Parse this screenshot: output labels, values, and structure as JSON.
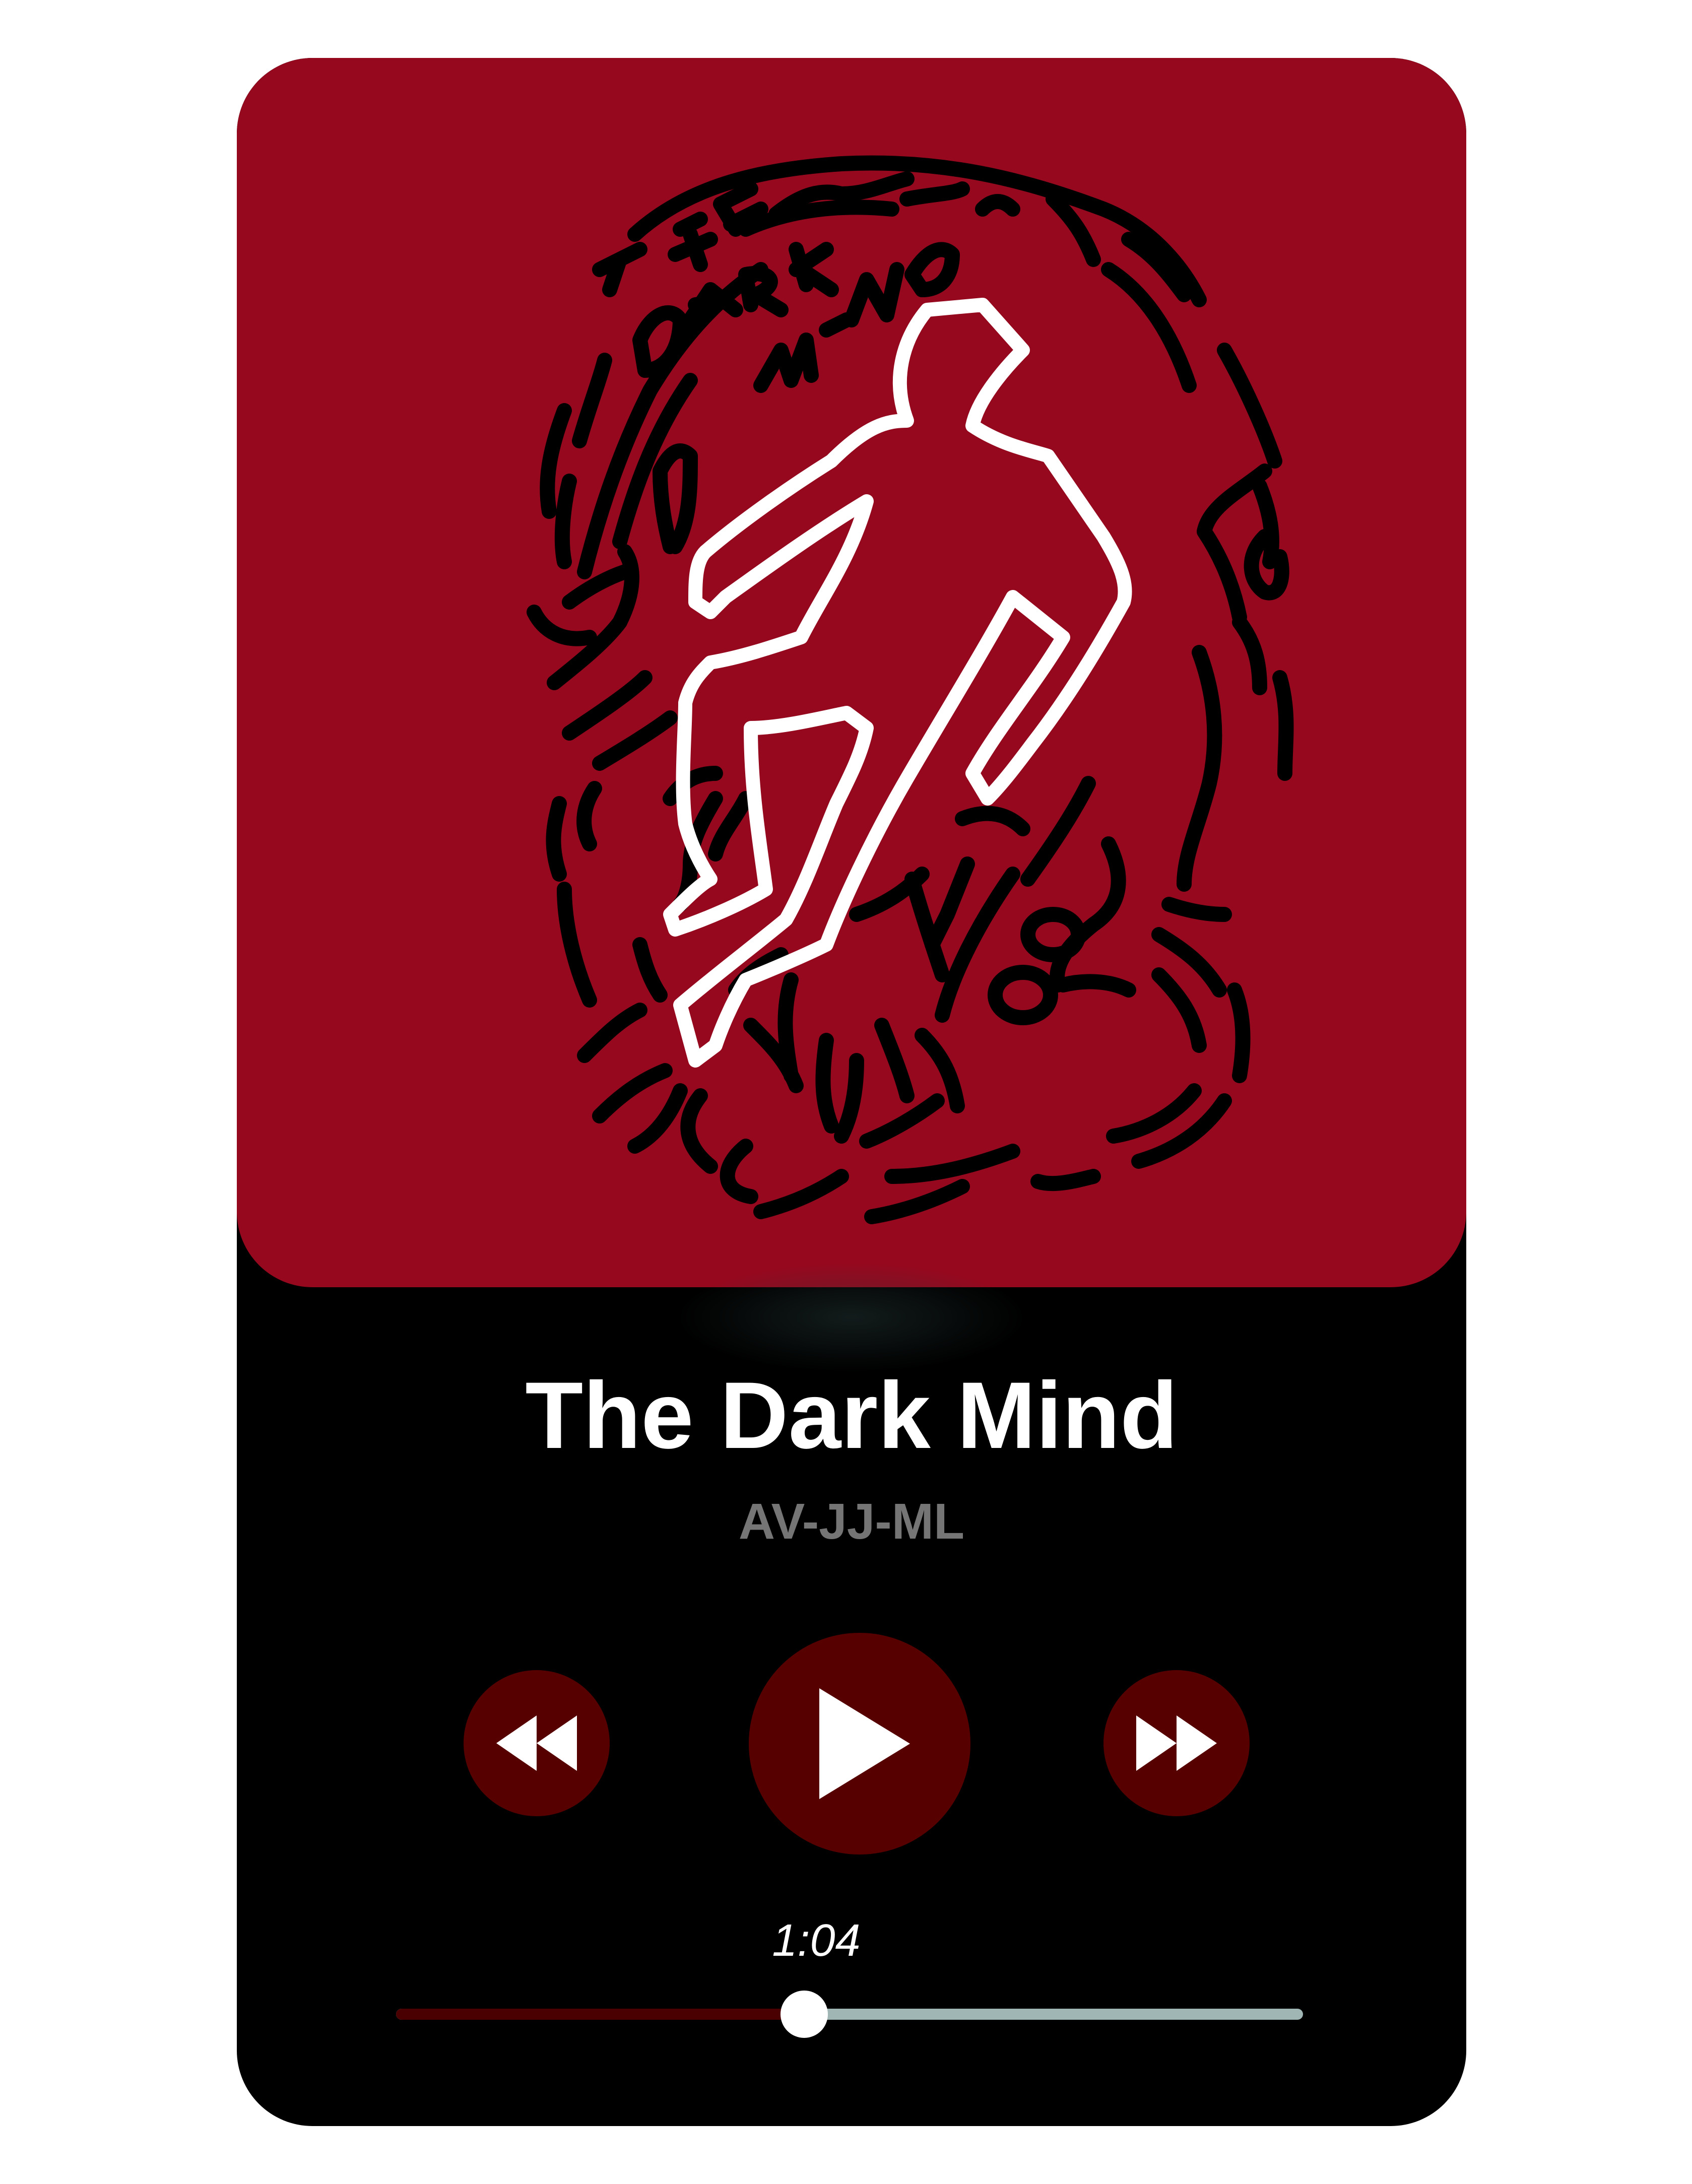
{
  "track": {
    "title": "The Dark Mind",
    "artist": "AV-JJ-ML"
  },
  "album_art": {
    "lettering": "THE DARK MIND 2 DOGS",
    "background_color": "#96081e",
    "linework_color": "#000000",
    "outline_color": "#ffffff"
  },
  "controls": {
    "rewind_icon": "rewind-icon",
    "play_icon": "play-icon",
    "forward_icon": "fast-forward-icon",
    "button_color": "#560000"
  },
  "progress": {
    "time": "1:04",
    "position_fraction": 0.45,
    "played_color": "#4a0000",
    "remaining_color": "#9fb6b5"
  }
}
